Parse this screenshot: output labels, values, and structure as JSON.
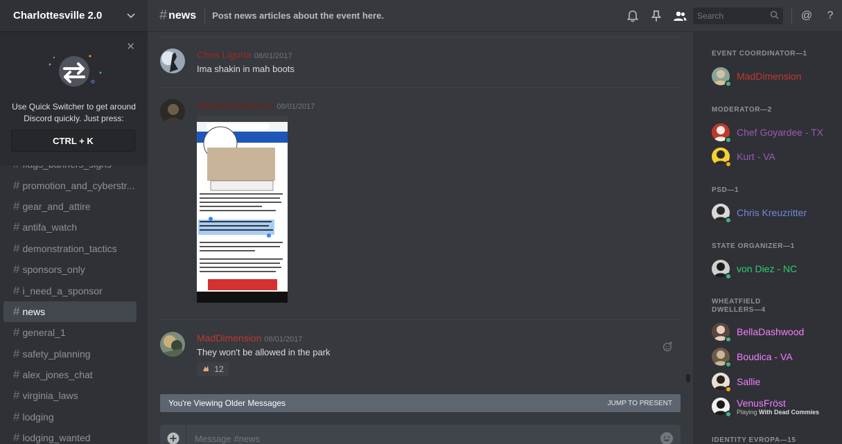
{
  "server": {
    "name": "Charlottesville 2.0"
  },
  "quick_switcher": {
    "description": "Use Quick Switcher to get around Discord quickly. Just press:",
    "shortcut": "CTRL + K"
  },
  "channels": [
    {
      "name": "flags_banners_signs",
      "active": false
    },
    {
      "name": "promotion_and_cyberstr...",
      "active": false
    },
    {
      "name": "gear_and_attire",
      "active": false
    },
    {
      "name": "antifa_watch",
      "active": false
    },
    {
      "name": "demonstration_tactics",
      "active": false
    },
    {
      "name": "sponsors_only",
      "active": false
    },
    {
      "name": "i_need_a_sponsor",
      "active": false
    },
    {
      "name": "news",
      "active": true
    },
    {
      "name": "general_1",
      "active": false
    },
    {
      "name": "safety_planning",
      "active": false
    },
    {
      "name": "alex_jones_chat",
      "active": false
    },
    {
      "name": "virginia_laws",
      "active": false
    },
    {
      "name": "lodging",
      "active": false
    },
    {
      "name": "lodging_wanted",
      "active": false
    }
  ],
  "header": {
    "channel_name": "news",
    "topic": "Post news articles about the event here.",
    "search_placeholder": "Search"
  },
  "messages": [
    {
      "author": "Chris Liguria",
      "author_color": "#992d22",
      "timestamp": "08/01/2017",
      "text": "Ima shakin in mah boots"
    },
    {
      "author": "Stannisthemannis",
      "author_color": "#71201a",
      "timestamp": "08/01/2017",
      "text": ""
    },
    {
      "author": "MadDimension",
      "author_color": "#c0392b",
      "timestamp": "08/01/2017",
      "text": "They won't be allowed in the park",
      "reaction_count": "12"
    }
  ],
  "older_banner": {
    "label": "You're Viewing Older Messages",
    "jump": "JUMP TO PRESENT"
  },
  "composer": {
    "placeholder": "Message #news"
  },
  "member_groups": [
    {
      "role": "EVENT COORDINATOR—1",
      "members": [
        {
          "name": "MadDimension",
          "color": "#c0392b",
          "status": "#43b581"
        }
      ]
    },
    {
      "role": "MODERATOR—2",
      "members": [
        {
          "name": "Chef Goyardee - TX",
          "color": "#9b59b6",
          "status": "#43b581"
        },
        {
          "name": "Kurt - VA",
          "color": "#9b59b6",
          "status": "#faa61a"
        }
      ]
    },
    {
      "role": "PSD—1",
      "members": [
        {
          "name": "Chris Kreuzritter",
          "color": "#7289da",
          "status": "#43b581"
        }
      ]
    },
    {
      "role": "STATE ORGANIZER—1",
      "members": [
        {
          "name": "von Diez - NC",
          "color": "#2ecc71",
          "status": "#43b581"
        }
      ]
    },
    {
      "role": "WHEATFIELD DWELLERS—4",
      "members": [
        {
          "name": "BellaDashwood",
          "color": "#f47fff",
          "status": "#43b581"
        },
        {
          "name": "Boudica - VA",
          "color": "#f47fff",
          "status": "#43b581"
        },
        {
          "name": "Sallie",
          "color": "#f47fff",
          "status": "#faa61a"
        },
        {
          "name": "VenusFröst",
          "color": "#f47fff",
          "status": "#43b581",
          "activity_prefix": "Playing",
          "activity_game": "With Dead Commies"
        }
      ]
    },
    {
      "role": "IDENTITY EVROPA—15",
      "members": []
    }
  ]
}
